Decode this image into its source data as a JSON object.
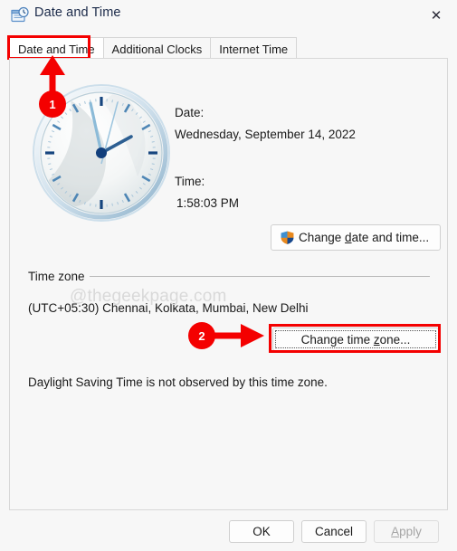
{
  "window": {
    "title": "Date and Time",
    "icon": "date-time-icon",
    "close_label": "✕"
  },
  "tabs": [
    {
      "label": "Date and Time",
      "active": true
    },
    {
      "label": "Additional Clocks",
      "active": false
    },
    {
      "label": "Internet Time",
      "active": false
    }
  ],
  "main": {
    "date_label": "Date:",
    "date_value": "Wednesday, September 14, 2022",
    "time_label": "Time:",
    "time_value": "1:58:03 PM",
    "change_datetime_button": "Change date and time...",
    "change_datetime_accesskey": "d",
    "clock": {
      "hour": 1,
      "minute": 58,
      "second": 3,
      "display": "1:58:03 PM"
    }
  },
  "timezone": {
    "group_title": "Time zone",
    "value": "(UTC+05:30) Chennai, Kolkata, Mumbai, New Delhi",
    "change_button": "Change time zone...",
    "change_accesskey": "z",
    "dst_text": "Daylight Saving Time is not observed by this time zone."
  },
  "footer": {
    "ok": "OK",
    "cancel": "Cancel",
    "apply": "Apply",
    "apply_disabled": true
  },
  "annotations": [
    {
      "id": "1",
      "label": "1",
      "target": "date-and-time-tab"
    },
    {
      "id": "2",
      "label": "2",
      "target": "change-time-zone-button"
    }
  ],
  "watermark": "@thegeekpage.com",
  "colors": {
    "annotation_red": "#f40000",
    "title_text": "#1c2b4a",
    "panel_bg": "#f7f7f7",
    "clock_blue": "#0d4f9e",
    "disabled_text": "#a5a5a5"
  }
}
